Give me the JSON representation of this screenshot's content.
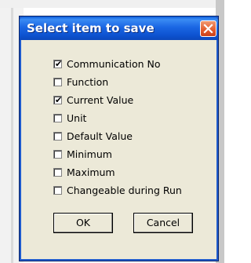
{
  "dialog": {
    "title": "Select item to save",
    "close_icon": "close-icon",
    "items": [
      {
        "label": "Communication No",
        "checked": true
      },
      {
        "label": "Function",
        "checked": false
      },
      {
        "label": "Current Value",
        "checked": true
      },
      {
        "label": "Unit",
        "checked": false
      },
      {
        "label": "Default Value",
        "checked": false
      },
      {
        "label": "Minimum",
        "checked": false
      },
      {
        "label": "Maximum",
        "checked": false
      },
      {
        "label": "Changeable during Run",
        "checked": false
      }
    ],
    "ok_label": "OK",
    "cancel_label": "Cancel"
  },
  "colors": {
    "titlebar": "#1b67e4",
    "dialog_bg": "#ece9d8",
    "close_button": "#e35a2b"
  }
}
